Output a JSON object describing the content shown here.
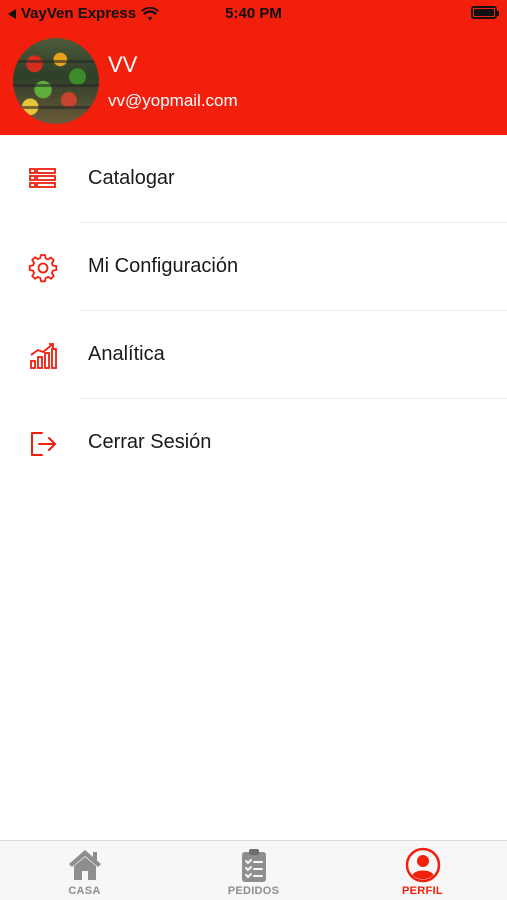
{
  "status_bar": {
    "carrier": "VayVen Express",
    "time": "5:40 PM"
  },
  "profile": {
    "name": "VV",
    "email": "vv@yopmail.com"
  },
  "menu": {
    "items": [
      {
        "label": "Catalogar",
        "icon": "list-icon"
      },
      {
        "label": "Mi Configuración",
        "icon": "gear-icon"
      },
      {
        "label": "Analítica",
        "icon": "chart-growth-icon"
      },
      {
        "label": "Cerrar Sesión",
        "icon": "logout-icon"
      }
    ]
  },
  "tabs": [
    {
      "label": "CASA",
      "icon": "home-icon",
      "active": false
    },
    {
      "label": "PEDIDOS",
      "icon": "clipboard-icon",
      "active": false
    },
    {
      "label": "PERFIL",
      "icon": "user-circle-icon",
      "active": true
    }
  ],
  "colors": {
    "brand": "#f21f0d",
    "tab_inactive": "#8e8e8e"
  }
}
